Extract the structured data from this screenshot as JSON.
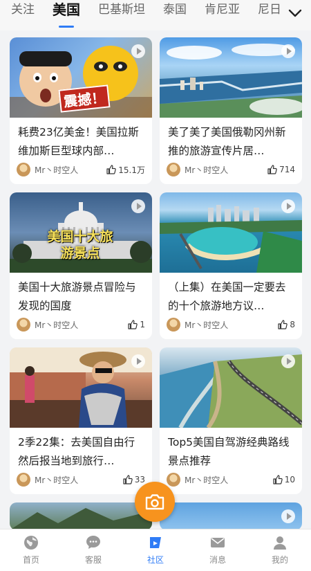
{
  "tabs": [
    {
      "label": "关注",
      "active": false
    },
    {
      "label": "美国",
      "active": true
    },
    {
      "label": "巴基斯坦",
      "active": false
    },
    {
      "label": "泰国",
      "active": false
    },
    {
      "label": "肯尼亚",
      "active": false
    },
    {
      "label": "尼日",
      "active": false
    }
  ],
  "tab_more_icon": "chevron-down-icon",
  "cards": [
    {
      "title": "耗费23亿美金！美国拉斯维加斯巨型球内部…",
      "author": "Mr丶时空人",
      "likes": "15.1万",
      "overlay_text": "震撼！"
    },
    {
      "title": "美了美了美国俄勒冈州新推的旅游宣传片居…",
      "author": "Mr丶时空人",
      "likes": "714",
      "overlay_text": ""
    },
    {
      "title": "美国十大旅游景点冒险与发现的国度",
      "author": "Mr丶时空人",
      "likes": "1",
      "overlay_text": "美国十大旅游景点"
    },
    {
      "title": "（上集）在美国一定要去的十个旅游地方议…",
      "author": "Mr丶时空人",
      "likes": "8",
      "overlay_text": ""
    },
    {
      "title": "2季22集：去美国自由行然后报当地到旅行…",
      "author": "Mr丶时空人",
      "likes": "33",
      "overlay_text": ""
    },
    {
      "title": "Top5美国自驾游经典路线景点推荐",
      "author": "Mr丶时空人",
      "likes": "10",
      "overlay_text": ""
    }
  ],
  "bottom_nav": [
    {
      "label": "首页",
      "icon": "globe-icon",
      "active": false
    },
    {
      "label": "客服",
      "icon": "chat-icon",
      "active": false
    },
    {
      "label": "社区",
      "icon": "community-icon",
      "active": true
    },
    {
      "label": "消息",
      "icon": "mail-icon",
      "active": false
    },
    {
      "label": "我的",
      "icon": "user-icon",
      "active": false
    }
  ],
  "colors": {
    "accent": "#2f7cf6",
    "fab": "#f7931e"
  }
}
